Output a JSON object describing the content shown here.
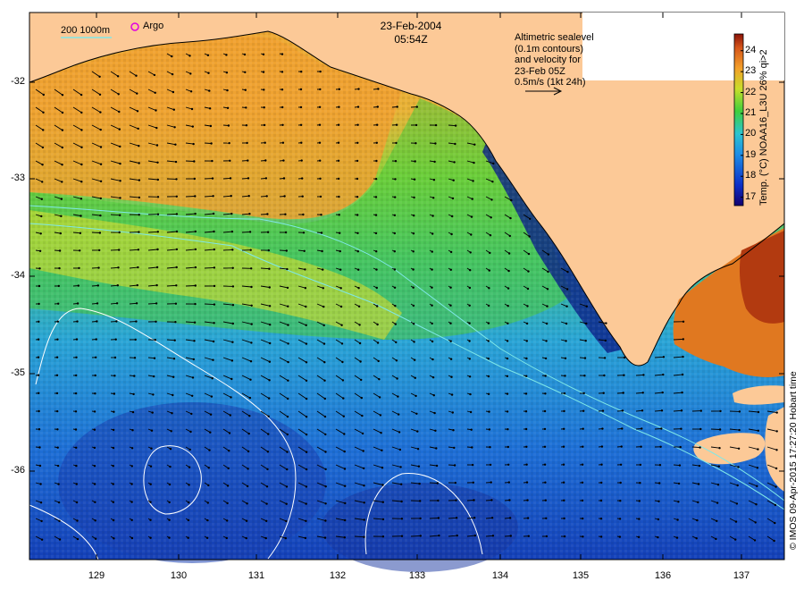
{
  "header": {
    "date": "23-Feb-2004",
    "time": "05:54Z"
  },
  "legend": {
    "depth_contours": "200  1000m",
    "argo": "Argo"
  },
  "info_box": {
    "line1": "Altimetric sealevel",
    "line2": "(0.1m contours)",
    "line3": "and velocity for",
    "line4": "23-Feb 05Z",
    "line5": "0.5m/s (1kt 24h)"
  },
  "colorbar": {
    "label": "Temp. (°C) NOAA16_L3U 26% qi>2",
    "ticks": [
      "24",
      "23",
      "22",
      "21",
      "20",
      "19",
      "18",
      "17"
    ],
    "min": 16.6,
    "max": 24.8
  },
  "axes": {
    "y_ticks": [
      "-32",
      "-33",
      "-34",
      "-35",
      "-36"
    ],
    "x_ticks": [
      "129",
      "130",
      "131",
      "132",
      "133",
      "134",
      "135",
      "136",
      "137"
    ]
  },
  "credit": "© IMOS 09-Apr-2015 17:27:20 Hobart time",
  "colors": {
    "land": "#fcc997",
    "contour": "#7fe8e8",
    "ssh_contour": "#ffffff",
    "argo": "#e000e0"
  }
}
